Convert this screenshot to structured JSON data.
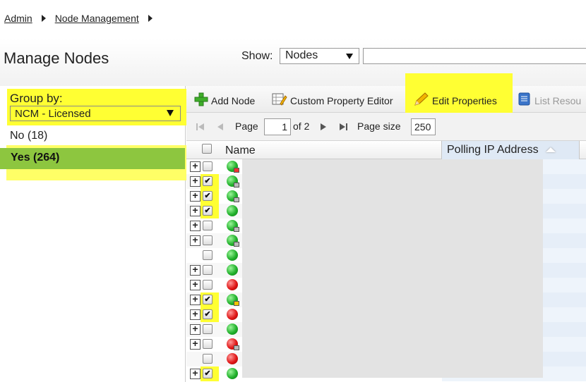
{
  "breadcrumb": {
    "items": [
      "Admin",
      "Node Management"
    ]
  },
  "page_title": "Manage Nodes",
  "show": {
    "label": "Show:",
    "selected": "Nodes",
    "search_value": ""
  },
  "group_by": {
    "label": "Group by:",
    "selected": "NCM - Licensed",
    "groups": [
      {
        "label": "No (18)"
      },
      {
        "label": "Yes (264)"
      }
    ]
  },
  "toolbar": {
    "add_node": "Add Node",
    "custom_property_editor": "Custom Property Editor",
    "edit_properties": "Edit Properties",
    "list_resources": "List Resou"
  },
  "pager": {
    "page_label": "Page",
    "page_value": "1",
    "of_label": "of 2",
    "page_size_label": "Page size",
    "page_size_value": "250"
  },
  "grid": {
    "columns": [
      "Name",
      "Polling IP Address"
    ],
    "rows": [
      {
        "expander": true,
        "checked": false,
        "status": "green",
        "badge": "red"
      },
      {
        "expander": true,
        "checked": true,
        "status": "green",
        "badge": "grey"
      },
      {
        "expander": true,
        "checked": true,
        "status": "green",
        "badge": "grey"
      },
      {
        "expander": true,
        "checked": true,
        "status": "green",
        "badge": ""
      },
      {
        "expander": true,
        "checked": false,
        "status": "green",
        "badge": "grey"
      },
      {
        "expander": true,
        "checked": false,
        "status": "green",
        "badge": "grey"
      },
      {
        "expander": false,
        "checked": false,
        "status": "green",
        "badge": ""
      },
      {
        "expander": true,
        "checked": false,
        "status": "green",
        "badge": ""
      },
      {
        "expander": true,
        "checked": false,
        "status": "red",
        "badge": ""
      },
      {
        "expander": true,
        "checked": true,
        "status": "green",
        "badge": "yellow"
      },
      {
        "expander": true,
        "checked": true,
        "status": "red",
        "badge": ""
      },
      {
        "expander": true,
        "checked": false,
        "status": "green",
        "badge": ""
      },
      {
        "expander": true,
        "checked": false,
        "status": "red",
        "badge": "grey"
      },
      {
        "expander": false,
        "checked": false,
        "status": "red",
        "badge": ""
      },
      {
        "expander": true,
        "checked": true,
        "status": "green",
        "badge": ""
      }
    ]
  },
  "colors": {
    "highlight": "#ffff33",
    "selected_group": "#8dc63f",
    "status_up": "#22b12c",
    "status_down": "#e01818"
  }
}
